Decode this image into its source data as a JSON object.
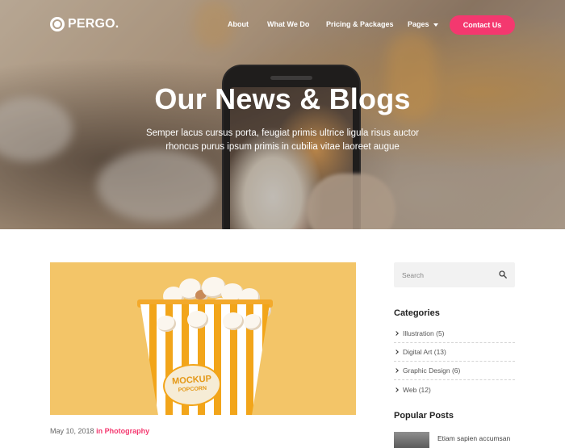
{
  "brand": {
    "name": "PERGO."
  },
  "nav": {
    "items": [
      "About",
      "What We Do",
      "Pricing & Packages",
      "Pages"
    ],
    "cta": "Contact Us"
  },
  "hero": {
    "title": "Our News & Blogs",
    "subtitle_line1": "Semper lacus cursus porta, feugiat primis ultrice ligula risus auctor",
    "subtitle_line2": "rhoncus purus ipsum primis in cubilia vitae laoreet augue"
  },
  "post": {
    "date": "May 10, 2018",
    "category_prefix": "in",
    "category": "Photography",
    "image_label_main": "MOCKUP",
    "image_label_sub": "POPCORN"
  },
  "sidebar": {
    "search_placeholder": "Search",
    "categories_heading": "Categories",
    "categories": [
      {
        "label": "Illustration",
        "count": "(5)"
      },
      {
        "label": "Digital Art",
        "count": "(13)"
      },
      {
        "label": "Graphic Design",
        "count": "(6)"
      },
      {
        "label": "Web",
        "count": "(12)"
      }
    ],
    "popular_heading": "Popular Posts",
    "popular_posts": [
      {
        "title": "Etiam sapien accumsan"
      }
    ]
  },
  "colors": {
    "accent": "#f4386f",
    "sidebar_bg": "#f2f2f2",
    "popcorn_bg": "#f3c568"
  },
  "icons": {
    "logo": "target-logo-icon",
    "search": "search-icon",
    "caret": "caret-down-icon",
    "chevron": "chevron-right-icon"
  }
}
